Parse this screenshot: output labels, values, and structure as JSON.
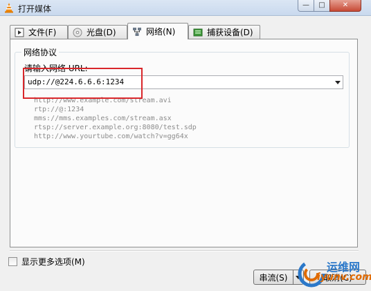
{
  "window": {
    "title": "打开媒体",
    "controls": {
      "minimize": "—",
      "maximize": "□",
      "close": "✕"
    }
  },
  "tabs": [
    {
      "label": "文件(F)",
      "icon": "file-play-icon",
      "active": false
    },
    {
      "label": "光盘(D)",
      "icon": "disc-icon",
      "active": false
    },
    {
      "label": "网络(N)",
      "icon": "network-icon",
      "active": true
    },
    {
      "label": "捕获设备(D)",
      "icon": "capture-device-icon",
      "active": false
    }
  ],
  "network": {
    "group_title": "网络协议",
    "url_label": "请输入网络 URL:",
    "url_value": "udp://@224.6.6.6:1234",
    "examples": [
      "http://www.example.com/stream.avi",
      "rtp://@:1234",
      "mms://mms.examples.com/stream.asx",
      "rtsp://server.example.org:8080/test.sdp",
      "http://www.yourtube.com/watch?v=gg64x"
    ]
  },
  "options": {
    "show_more_label": "显示更多选项(M)",
    "checked": false
  },
  "buttons": {
    "stream_label": "串流(S)",
    "cancel_label": "取消(C)"
  },
  "watermark": {
    "line1": "运维网",
    "line2": "iyunv.com"
  },
  "colors": {
    "highlight": "#d9262a",
    "titlebar": "#c9d9ee",
    "close_button": "#c74a35"
  }
}
